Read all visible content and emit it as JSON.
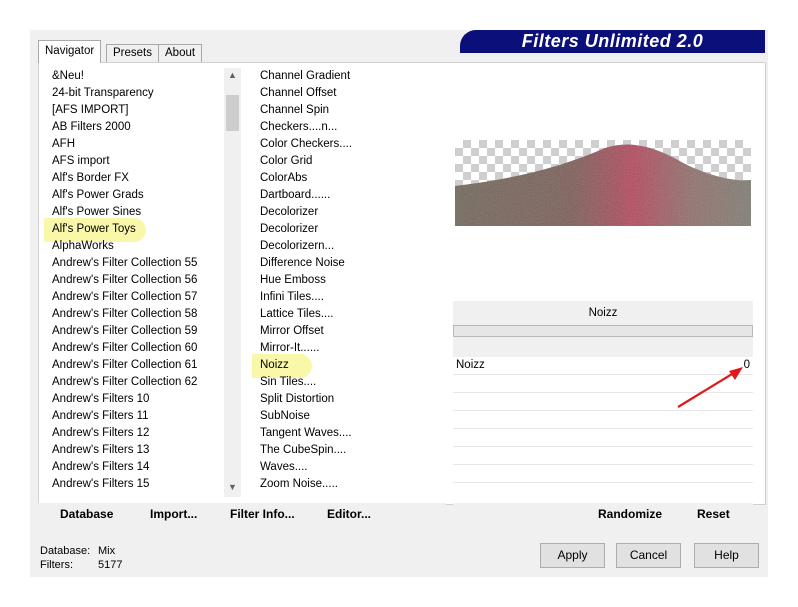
{
  "banner": "Filters Unlimited 2.0",
  "tabs": [
    "Navigator",
    "Presets",
    "About"
  ],
  "categories": [
    {
      "label": "&Neu!"
    },
    {
      "label": "24-bit Transparency"
    },
    {
      "label": "[AFS IMPORT]"
    },
    {
      "label": "AB Filters 2000"
    },
    {
      "label": "AFH"
    },
    {
      "label": "AFS import"
    },
    {
      "label": "Alf's Border FX"
    },
    {
      "label": "Alf's Power Grads"
    },
    {
      "label": "Alf's Power Sines"
    },
    {
      "label": "Alf's Power Toys",
      "selected": true
    },
    {
      "label": "AlphaWorks"
    },
    {
      "label": "Andrew's Filter Collection 55"
    },
    {
      "label": "Andrew's Filter Collection 56"
    },
    {
      "label": "Andrew's Filter Collection 57"
    },
    {
      "label": "Andrew's Filter Collection 58"
    },
    {
      "label": "Andrew's Filter Collection 59"
    },
    {
      "label": "Andrew's Filter Collection 60"
    },
    {
      "label": "Andrew's Filter Collection 61"
    },
    {
      "label": "Andrew's Filter Collection 62"
    },
    {
      "label": "Andrew's Filters 10"
    },
    {
      "label": "Andrew's Filters 11"
    },
    {
      "label": "Andrew's Filters 12"
    },
    {
      "label": "Andrew's Filters 13"
    },
    {
      "label": "Andrew's Filters 14"
    },
    {
      "label": "Andrew's Filters 15"
    }
  ],
  "filters": [
    {
      "label": "Channel Gradient"
    },
    {
      "label": "Channel Offset"
    },
    {
      "label": "Channel Spin"
    },
    {
      "label": "Checkers....n..."
    },
    {
      "label": "Color Checkers...."
    },
    {
      "label": "Color Grid"
    },
    {
      "label": "ColorAbs"
    },
    {
      "label": "Dartboard......"
    },
    {
      "label": "Decolorizer"
    },
    {
      "label": "Decolorizer"
    },
    {
      "label": "Decolorizern..."
    },
    {
      "label": "Difference Noise"
    },
    {
      "label": "Hue Emboss"
    },
    {
      "label": "Infini Tiles...."
    },
    {
      "label": "Lattice Tiles...."
    },
    {
      "label": "Mirror Offset"
    },
    {
      "label": "Mirror-It......"
    },
    {
      "label": "Noizz",
      "selected": true
    },
    {
      "label": "Sin Tiles...."
    },
    {
      "label": "Split Distortion"
    },
    {
      "label": "SubNoise"
    },
    {
      "label": "Tangent Waves...."
    },
    {
      "label": "The CubeSpin...."
    },
    {
      "label": "Waves...."
    },
    {
      "label": "Zoom Noise....."
    }
  ],
  "param_title": "Noizz",
  "param": {
    "label": "Noizz",
    "value": "0"
  },
  "bottom_buttons": [
    "Database",
    "Import...",
    "Filter Info...",
    "Editor..."
  ],
  "right_buttons": [
    "Randomize",
    "Reset"
  ],
  "status": {
    "db_label": "Database:",
    "db_value": "Mix",
    "f_label": "Filters:",
    "f_value": "5177"
  },
  "dialog_buttons": [
    "Apply",
    "Cancel",
    "Help"
  ],
  "colors": {
    "banner": "#0a0f7a",
    "highlight": "#f8f79a",
    "arrow": "#e01a1a"
  }
}
